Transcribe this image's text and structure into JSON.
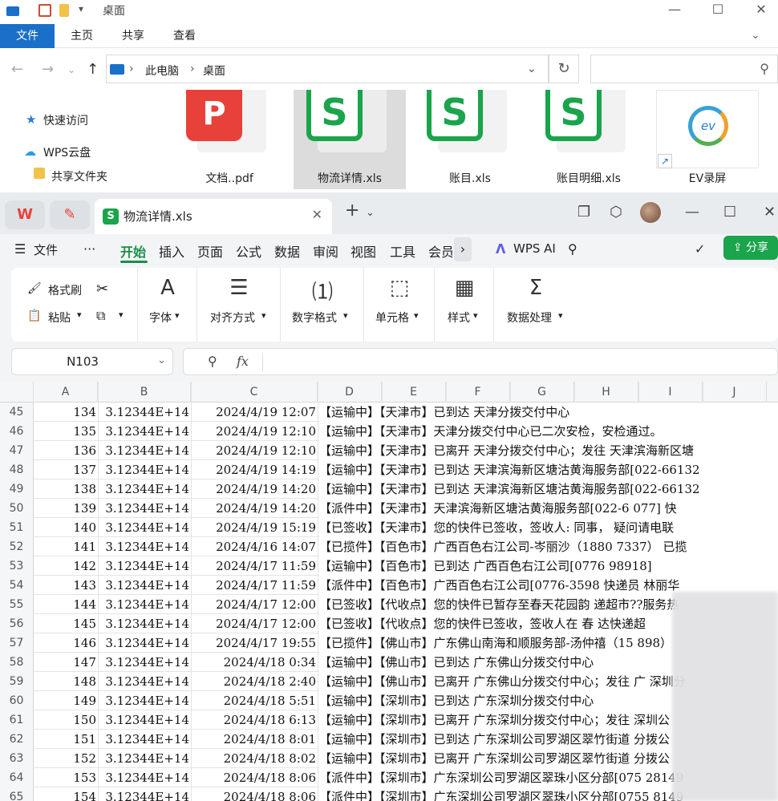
{
  "explorer": {
    "title": "桌面",
    "tabs": [
      "文件",
      "主页",
      "共享",
      "查看"
    ],
    "breadcrumb": [
      "此电脑",
      "桌面"
    ],
    "nav": [
      "快速访问",
      "WPS云盘",
      "共享文件夹"
    ],
    "files": [
      {
        "name": "文档..pdf",
        "type": "pdf"
      },
      {
        "name": "物流详情.xls",
        "type": "xls",
        "selected": true
      },
      {
        "name": "账目.xls",
        "type": "xls"
      },
      {
        "name": "账目明细.xls",
        "type": "xls"
      },
      {
        "name": "EV录屏",
        "type": "shortcut"
      }
    ]
  },
  "wps": {
    "tab_name": "物流详情.xls",
    "menu": [
      "文件",
      "开始",
      "插入",
      "页面",
      "公式",
      "数据",
      "审阅",
      "视图",
      "工具",
      "会员"
    ],
    "active_menu": "开始",
    "ai_label": "WPS AI",
    "share_label": "分享",
    "ribbon": {
      "format_painter": "格式刷",
      "paste": "粘贴",
      "font": "字体",
      "align": "对齐方式",
      "number_format": "数字格式",
      "cell": "单元格",
      "style": "样式",
      "data_processing": "数据处理"
    },
    "name_box": "N103",
    "fx_label": "fx",
    "accent_color": "#1aa44c"
  },
  "grid": {
    "columns": [
      "A",
      "B",
      "C",
      "D",
      "E",
      "F",
      "G",
      "H",
      "I",
      "J"
    ],
    "rows": [
      {
        "n": "45",
        "a": "134",
        "b": "3.12344E+14",
        "c": "2024/4/19 12:07",
        "d": "【运输中】【天津市】已到达 天津分拨交付中心"
      },
      {
        "n": "46",
        "a": "135",
        "b": "3.12344E+14",
        "c": "2024/4/19 12:10",
        "d": "【运输中】【天津市】天津分拨交付中心已二次安检，安检通过。"
      },
      {
        "n": "47",
        "a": "136",
        "b": "3.12344E+14",
        "c": "2024/4/19 12:10",
        "d": "【运输中】【天津市】已离开 天津分拨交付中心；发往 天津滨海新区塘"
      },
      {
        "n": "48",
        "a": "137",
        "b": "3.12344E+14",
        "c": "2024/4/19 14:19",
        "d": "【运输中】【天津市】已到达 天津滨海新区塘沽黄海服务部[022-66132"
      },
      {
        "n": "49",
        "a": "138",
        "b": "3.12344E+14",
        "c": "2024/4/19 14:20",
        "d": "【运输中】【天津市】已到达 天津滨海新区塘沽黄海服务部[022-66132"
      },
      {
        "n": "50",
        "a": "139",
        "b": "3.12344E+14",
        "c": "2024/4/19 14:20",
        "d": "【派件中】【天津市】天津滨海新区塘沽黄海服务部[022-6  077] 快"
      },
      {
        "n": "51",
        "a": "140",
        "b": "3.12344E+14",
        "c": "2024/4/19 15:19",
        "d": "【已签收】【天津市】您的快件已签收，签收人: 同事，  疑问请电联"
      },
      {
        "n": "52",
        "a": "141",
        "b": "3.12344E+14",
        "c": "2024/4/16 14:07",
        "d": "【已揽件】【百色市】广西百色右江公司-岑丽沙（1880  7337） 已揽"
      },
      {
        "n": "53",
        "a": "142",
        "b": "3.12344E+14",
        "c": "2024/4/17 11:59",
        "d": "【运输中】【百色市】已到达 广西百色右江公司[0776  98918]"
      },
      {
        "n": "54",
        "a": "143",
        "b": "3.12344E+14",
        "c": "2024/4/17 11:59",
        "d": "【派件中】【百色市】广西百色右江公司[0776-3598  快递员 林丽华"
      },
      {
        "n": "55",
        "a": "144",
        "b": "3.12344E+14",
        "c": "2024/4/17 12:00",
        "d": "【已签收】【代收点】您的快件已暂存至春天花园韵  递超市??服务热"
      },
      {
        "n": "56",
        "a": "145",
        "b": "3.12344E+14",
        "c": "2024/4/17 12:00",
        "d": "【已签收】【代收点】您的快件已签收，签收人在 春  达快递超"
      },
      {
        "n": "57",
        "a": "146",
        "b": "3.12344E+14",
        "c": "2024/4/17 19:55",
        "d": "【已揽件】【佛山市】广东佛山南海和顺服务部-汤仲禧（15  898）"
      },
      {
        "n": "58",
        "a": "147",
        "b": "3.12344E+14",
        "c": "2024/4/18 0:34",
        "d": "【运输中】【佛山市】已到达 广东佛山分拨交付中心"
      },
      {
        "n": "59",
        "a": "148",
        "b": "3.12344E+14",
        "c": "2024/4/18 2:40",
        "d": "【运输中】【佛山市】已离开 广东佛山分拨交付中心；发往 广  深圳分"
      },
      {
        "n": "60",
        "a": "149",
        "b": "3.12344E+14",
        "c": "2024/4/18 5:51",
        "d": "【运输中】【深圳市】已到达 广东深圳分拨交付中心"
      },
      {
        "n": "61",
        "a": "150",
        "b": "3.12344E+14",
        "c": "2024/4/18 6:13",
        "d": "【运输中】【深圳市】已离开 广东深圳分拨交付中心；发往  深圳公"
      },
      {
        "n": "62",
        "a": "151",
        "b": "3.12344E+14",
        "c": "2024/4/18 8:01",
        "d": "【运输中】【深圳市】已到达 广东深圳公司罗湖区翠竹街道  分拨公"
      },
      {
        "n": "63",
        "a": "152",
        "b": "3.12344E+14",
        "c": "2024/4/18 8:02",
        "d": "【运输中】【深圳市】已离开 广东深圳公司罗湖区翠竹街道  分拨公"
      },
      {
        "n": "64",
        "a": "153",
        "b": "3.12344E+14",
        "c": "2024/4/18 8:06",
        "d": "【派件中】【深圳市】广东深圳公司罗湖区翠珠小区分部[075  28149"
      },
      {
        "n": "65",
        "a": "154",
        "b": "3.12344E+14",
        "c": "2024/4/18 8:06",
        "d": "【派件中】【深圳市】广东深圳公司罗湖区翠珠小区分部[0755  8149"
      }
    ]
  }
}
